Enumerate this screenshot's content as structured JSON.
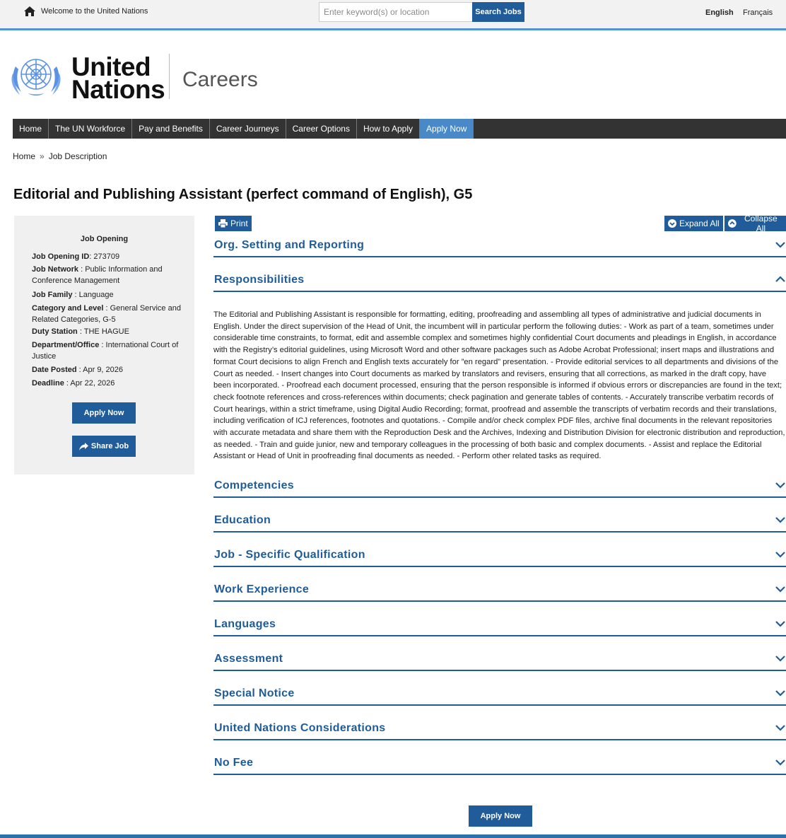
{
  "topbar": {
    "welcome": "Welcome to the United Nations",
    "search_placeholder": "Enter keyword(s) or location",
    "search_button": "Search Jobs",
    "lang_english": "English",
    "lang_french": "Français"
  },
  "header": {
    "brand_line1": "United",
    "brand_line2": "Nations",
    "section": "Careers"
  },
  "nav": [
    "Home",
    "The UN Workforce",
    "Pay and Benefits",
    "Career Journeys",
    "Career Options",
    "How to Apply",
    "Apply Now"
  ],
  "breadcrumb": {
    "home": "Home",
    "separator": "»",
    "current": "Job Description"
  },
  "page_title": "Editorial and Publishing Assistant (perfect command of English), G5",
  "job_card": {
    "title": "Job Opening",
    "fields": [
      {
        "label": "Job Opening ID",
        "value": "273709"
      },
      {
        "label": "Job Network",
        "value": "Public Information and Conference Management"
      },
      {
        "label": "Job Family",
        "value": "Language"
      },
      {
        "label": "Category and Level",
        "value": "General Service and Related Categories, G-5"
      },
      {
        "label": "Duty Station",
        "value": "THE HAGUE"
      },
      {
        "label": "Department/Office",
        "value": "International Court of Justice"
      },
      {
        "label": "Date Posted",
        "value": "Apr 9, 2026"
      },
      {
        "label": "Deadline",
        "value": "Apr 22, 2026"
      }
    ],
    "apply_button": "Apply Now",
    "share_button": "Share Job"
  },
  "toolbar": {
    "print": "Print",
    "expand_all": "Expand All",
    "collapse_all": "Collapse All"
  },
  "sections": [
    {
      "title": "Org. Setting and Reporting",
      "expanded": false
    },
    {
      "title": "Responsibilities",
      "expanded": true
    },
    {
      "title": "Competencies",
      "expanded": false
    },
    {
      "title": "Education",
      "expanded": false
    },
    {
      "title": "Job - Specific Qualification",
      "expanded": false
    },
    {
      "title": "Work Experience",
      "expanded": false
    },
    {
      "title": "Languages",
      "expanded": false
    },
    {
      "title": "Assessment",
      "expanded": false
    },
    {
      "title": "Special Notice",
      "expanded": false
    },
    {
      "title": "United Nations Considerations",
      "expanded": false
    },
    {
      "title": "No Fee",
      "expanded": false
    }
  ],
  "responsibilities_text": "The Editorial and Publishing Assistant is responsible for formatting, editing, proofreading and assembling all types of administrative and judicial documents in English.   Under the direct supervision of the Head of Unit, the incumbent will in particular perform the following duties: - Work as part of a team, sometimes under considerable time constraints, to format, edit and assemble complex and sometimes highly confidential Court documents and pleadings in English, in accordance with the Registry’s editorial guidelines, using Microsoft Word and other software packages such as Adobe Acrobat Professional; insert maps and illustrations and format Court decisions to align French and English texts accurately for ”en regard” presentation. - Provide editorial services to all departments and divisions of the Court as needed. - Insert changes into Court documents as marked by translators and revisers, ensuring that all corrections, as marked in the draft copy, have been incorporated. - Proofread each document processed, ensuring that the person responsible is informed if obvious errors or discrepancies are found in the text; check footnote references and cross-references within documents; check pagination and generate tables of contents. - Accurately transcribe verbatim records of Court hearings, within a strict timeframe, using Digital Audio Recording; format, proofread and assemble the transcripts of verbatim records and their translations, including verification of ICJ references, footnotes and quotations. - Compile and/or check complex PDF files, archive final documents in the relevant repositories with accurate metadata and share them with the Reproduction Desk and the Archives, Indexing and Distribution Division for electronic distribution and reproduction, as needed.  - Train and guide junior, new and temporary colleagues in the processing of both basic and complex documents. - Assist and replace the Editorial Assistant or Head of Unit in proofreading final documents as needed. - Perform other related tasks as required.",
  "bottom_apply": "Apply Now",
  "colors": {
    "primary": "#1f5c99",
    "nav_bg": "#333333",
    "nav_active": "#4a89c8",
    "top_rule": "#4d94d0"
  }
}
